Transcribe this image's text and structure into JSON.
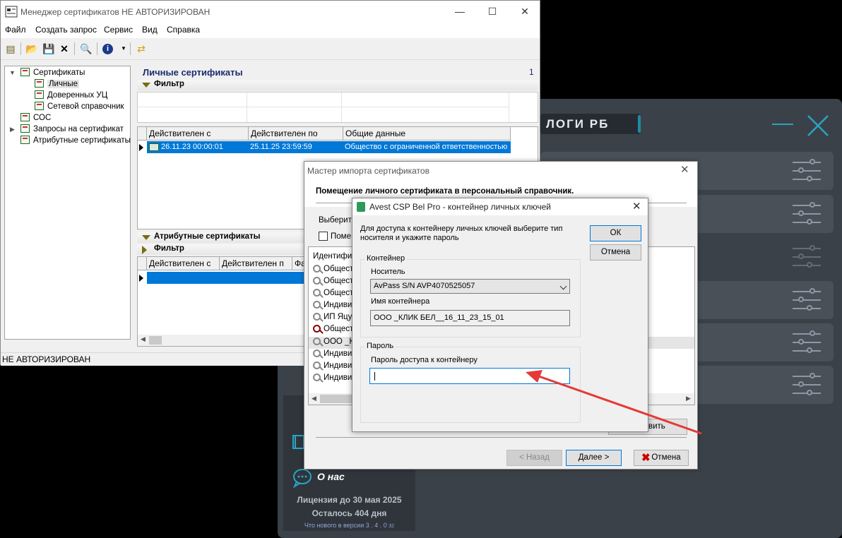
{
  "background_app": {
    "header_title": "ЛОГИ РБ",
    "about_label": "О нас",
    "license_text": "Лицензия до 30 мая 2025",
    "days_left_text": "Осталось 404 дня",
    "whats_new": "Что нового в версии 3 . 4 . 0",
    "whats_new_sub": "32",
    "colors": {
      "panel": "#3b4148",
      "accent": "#2aa4c4"
    }
  },
  "main_window": {
    "title": "Менеджер сертификатов  НЕ АВТОРИЗИРОВАН",
    "menu": [
      "Файл",
      "Создать запрос",
      "Сервис",
      "Вид",
      "Справка"
    ],
    "toolbar_icons": [
      "books-icon",
      "import-icon",
      "save-icon",
      "delete-icon",
      "preview-icon",
      "info-icon",
      "refresh-icon"
    ],
    "tree": {
      "root": "Сертификаты",
      "children": [
        "Личные",
        "Доверенных УЦ",
        "Сетевой справочник"
      ],
      "others": [
        "СОС",
        "Запросы на сертификат",
        "Атрибутные сертификаты"
      ]
    },
    "pane_title": "Личные сертификаты",
    "pane_count": "1",
    "filter_label": "Фильтр",
    "cert_columns": [
      "Действителен с",
      "Действителен по",
      "Общие данные"
    ],
    "cert_rows": [
      {
        "from": "26.11.23 00:00:01",
        "to": "25.11.25 23:59:59",
        "info": "Общество с ограниченной ответственностью"
      }
    ],
    "attr_section_label": "Атрибутные сертификаты",
    "attr_filter_label": "Фильтр",
    "attr_columns": [
      "Действителен с",
      "Действителен п",
      "Фа"
    ],
    "status": "НЕ АВТОРИЗИРОВАН"
  },
  "wizard": {
    "title": "Мастер импорта сертификатов",
    "heading": "Помещение личного сертификата в персональный справочник.",
    "choose_label": "Выберите",
    "checkbox_label": "Поме",
    "list_header": "Идентифик",
    "list_items": [
      "Общест",
      "Общест",
      "Общест",
      "Индиви",
      "ИП Яцу",
      "Общест",
      "ООО _К",
      "Индиви",
      "Индиви",
      "Индиви"
    ],
    "refresh_label": "обновить",
    "back_label": "< Назад",
    "next_label": "Далее >",
    "cancel_label": "Отмена"
  },
  "avest": {
    "title": "Avest CSP Bel Pro - контейнер личных ключей",
    "hint": "Для доступа к контейнеру личных ключей выберите тип носителя и укажите пароль",
    "ok_label": "ОК",
    "cancel_label": "Отмена",
    "container_group": "Контейнер",
    "carrier_label": "Носитель",
    "carrier_value": "AvPass S/N AVP4070525057",
    "container_name_label": "Имя контейнера",
    "container_name_value": "ООО _КЛИК БЕЛ__16_11_23_15_01",
    "password_group": "Пароль",
    "password_label": "Пароль доступа к контейнеру",
    "password_value": ""
  }
}
